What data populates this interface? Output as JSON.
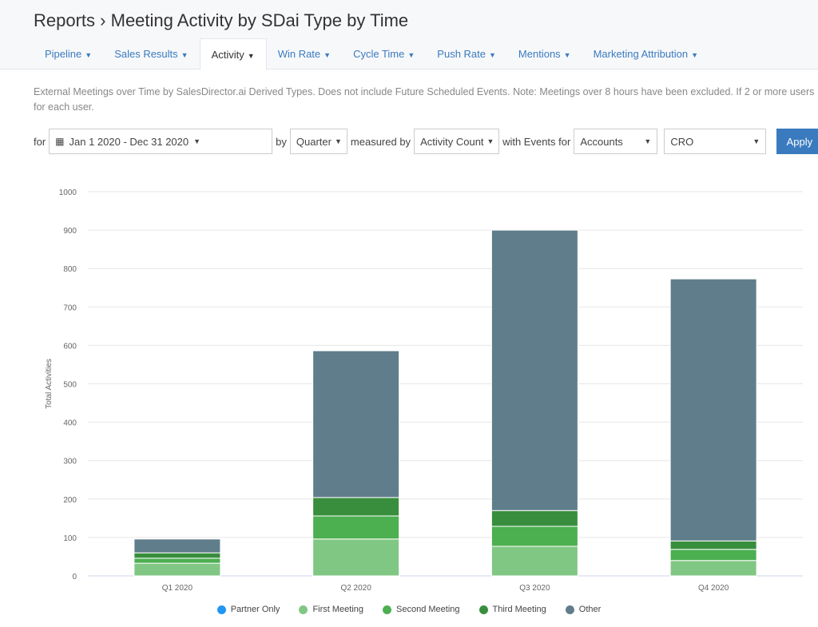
{
  "header": {
    "breadcrumb_root": "Reports",
    "separator": "›",
    "title": "Meeting Activity by SDai Type by Time"
  },
  "tabs": [
    {
      "label": "Pipeline"
    },
    {
      "label": "Sales Results"
    },
    {
      "label": "Activity",
      "active": true
    },
    {
      "label": "Win Rate"
    },
    {
      "label": "Cycle Time"
    },
    {
      "label": "Push Rate"
    },
    {
      "label": "Mentions"
    },
    {
      "label": "Marketing Attribution"
    }
  ],
  "description": {
    "line1": "External Meetings over Time by SalesDirector.ai Derived Types. Does not include Future Scheduled Events. Note: Meetings over 8 hours have been excluded. If 2 or more users",
    "line2": "for each user."
  },
  "filters": {
    "for_label": "for",
    "date_range": "Jan 1 2020 - Dec 31 2020",
    "by_label": "by",
    "period": "Quarter",
    "measured_label": "measured by",
    "measure": "Activity Count",
    "events_label": "with Events for",
    "entity": "Accounts",
    "role": "CRO",
    "apply": "Apply"
  },
  "chart_data": {
    "type": "bar",
    "stacked": true,
    "categories": [
      "Q1 2020",
      "Q2 2020",
      "Q3 2020",
      "Q4 2020"
    ],
    "ylabel": "Total Activities",
    "ylim": [
      0,
      1000
    ],
    "yticks": [
      0,
      100,
      200,
      300,
      400,
      500,
      600,
      700,
      800,
      900,
      1000
    ],
    "grid": true,
    "legend": "bottom",
    "series": [
      {
        "name": "Partner Only",
        "color": "#2196f3",
        "values": [
          0,
          0,
          0,
          0
        ]
      },
      {
        "name": "First Meeting",
        "color": "#81c784",
        "values": [
          33,
          96,
          77,
          40
        ]
      },
      {
        "name": "Second Meeting",
        "color": "#4caf50",
        "values": [
          13,
          60,
          52,
          29
        ]
      },
      {
        "name": "Third Meeting",
        "color": "#388e3c",
        "values": [
          14,
          48,
          41,
          22
        ]
      },
      {
        "name": "Other",
        "color": "#607d8b",
        "values": [
          36,
          382,
          730,
          682
        ]
      }
    ]
  }
}
